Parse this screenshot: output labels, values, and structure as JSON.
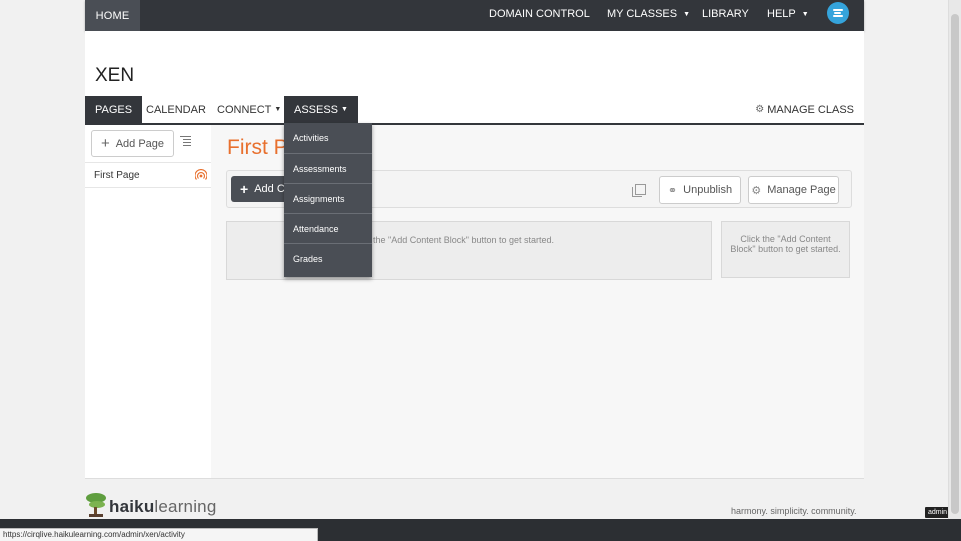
{
  "topnav": {
    "home": "HOME",
    "domain_control": "DOMAIN CONTROL",
    "my_classes": "MY CLASSES",
    "library": "LIBRARY",
    "help": "HELP"
  },
  "class": {
    "title": "XEN"
  },
  "subnav": {
    "pages": "PAGES",
    "calendar": "CALENDAR",
    "connect": "CONNECT",
    "assess": "ASSESS",
    "manage_class": "MANAGE CLASS"
  },
  "sidebar": {
    "add_page": "Add Page",
    "pages": [
      {
        "label": "First Page"
      }
    ]
  },
  "content": {
    "page_title": "First P",
    "add_block": "Add C",
    "unpublish": "Unpublish",
    "manage_page": "Manage Page",
    "empty_main": "k the \"Add Content Block\" button to get started.",
    "empty_side": "Click the \"Add Content Block\" button to get started."
  },
  "assess_menu": {
    "items": [
      "Activities",
      "Assessments",
      "Assignments",
      "Attendance",
      "Grades"
    ]
  },
  "footer": {
    "logo_haiku": "haiku",
    "logo_learning": "learning",
    "tagline": "harmony. simplicity. community.",
    "admin": "admin"
  },
  "status_bar": {
    "url": "https://cirqlive.haikulearning.com/admin/xen/activity"
  },
  "colors": {
    "nav_dark": "#33363b",
    "accent_orange": "#e8702e",
    "profile_blue": "#35a4dc"
  }
}
